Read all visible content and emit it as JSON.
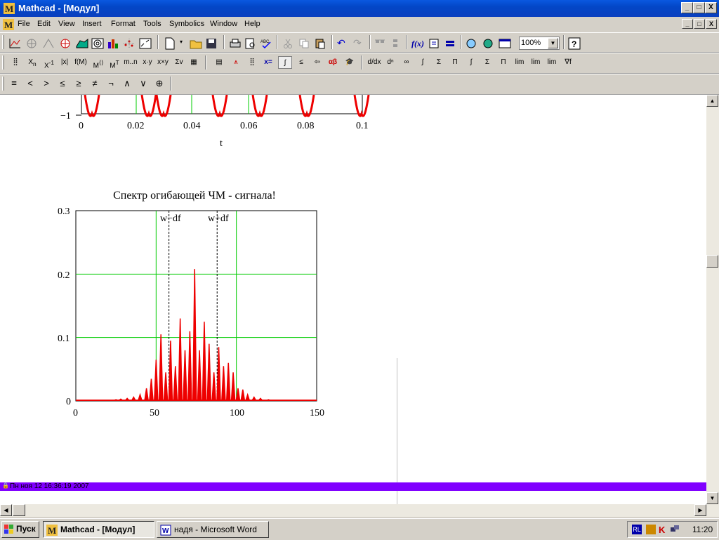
{
  "window": {
    "title": "Mathcad - [Модул]",
    "controls": {
      "minimize": "_",
      "maximize": "□",
      "close": "X"
    }
  },
  "menu": {
    "items": [
      "File",
      "Edit",
      "View",
      "Insert",
      "Format",
      "Tools",
      "Symbolics",
      "Window",
      "Help"
    ]
  },
  "toolbar": {
    "zoom": "100%",
    "fx_label": "f(x)",
    "math_labels": [
      "x=",
      "αβ"
    ]
  },
  "boolean_toolbar": {
    "items": [
      "=",
      "<",
      ">",
      "≤",
      "≥",
      "≠",
      "¬",
      "∧",
      "∨",
      "⊕"
    ]
  },
  "plot_top": {
    "y_tick": "−1",
    "x_ticks": [
      "0",
      "0.02",
      "0.04",
      "0.06",
      "0.08",
      "0.1"
    ],
    "x_label": "t"
  },
  "plot_spectrum": {
    "title": "Спектр огибающей ЧМ - сигнала!",
    "marker_left": "w−df",
    "marker_right": "w+df",
    "y_ticks": [
      "0.3",
      "0.2",
      "0.1",
      "0"
    ],
    "x_ticks": [
      "0",
      "50",
      "100",
      "150"
    ]
  },
  "chart_data": {
    "type": "line",
    "title": "Спектр огибающей ЧМ - сигнала!",
    "xlim": [
      0,
      150
    ],
    "ylim": [
      0,
      0.3
    ],
    "grid": true,
    "markers": [
      {
        "label": "w−df",
        "x": 58
      },
      {
        "label": "w+df",
        "x": 88
      }
    ],
    "peaks_x": [
      20,
      25,
      28,
      32,
      36,
      40,
      44,
      47,
      50,
      53,
      56,
      59,
      62,
      65,
      68,
      71,
      74,
      77,
      80,
      83,
      86,
      89,
      92,
      95,
      98,
      101,
      104,
      107,
      111,
      115,
      120,
      125
    ],
    "peaks_y": [
      0.001,
      0.002,
      0.003,
      0.004,
      0.006,
      0.01,
      0.02,
      0.035,
      0.065,
      0.105,
      0.045,
      0.095,
      0.055,
      0.13,
      0.08,
      0.11,
      0.208,
      0.08,
      0.125,
      0.09,
      0.045,
      0.085,
      0.055,
      0.06,
      0.045,
      0.02,
      0.018,
      0.01,
      0.006,
      0.004,
      0.002,
      0.001
    ]
  },
  "region_footer": {
    "text": "Пн ноя 12 16:36:19 2007"
  },
  "taskbar": {
    "start": "Пуск",
    "tasks": [
      "Mathcad - [Модул]",
      "надя - Microsoft Word"
    ],
    "lang": "RL",
    "clock": "11:20"
  }
}
